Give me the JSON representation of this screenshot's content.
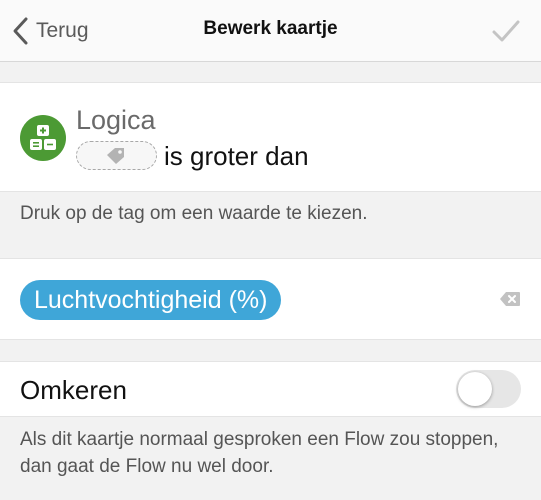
{
  "nav": {
    "back_label": "Terug",
    "title": "Bewerk kaartje",
    "confirm_icon": "checkmark-icon",
    "back_icon": "chevron-left-icon"
  },
  "card": {
    "app_name": "Logica",
    "app_icon": "logic-app-icon",
    "app_color": "#4c9a34",
    "tag_icon": "tag-icon",
    "condition_text": "is groter dan"
  },
  "hint_tag": "Druk op de tag om een waarde te kiezen.",
  "value": {
    "pill_label": "Luchtvochtigheid (%)",
    "pill_color": "#3fa6d8",
    "clear_icon": "backspace-icon"
  },
  "invert": {
    "label": "Omkeren",
    "enabled": false
  },
  "hint_invert": "Als dit kaartje normaal gesproken een Flow zou stoppen, dan gaat de Flow nu wel door."
}
